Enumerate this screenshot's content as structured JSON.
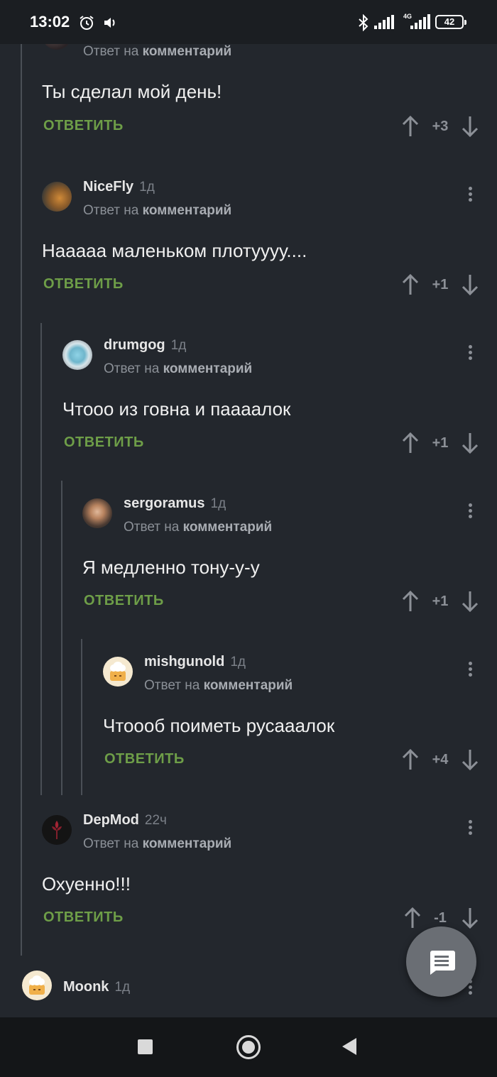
{
  "status_bar": {
    "time": "13:02",
    "network": "4G",
    "battery": "42"
  },
  "labels": {
    "reply_to_prefix": "Ответ на",
    "reply_to_target": "комментарий",
    "reply_button": "ОТВЕТИТЬ"
  },
  "comments": [
    {
      "author": "",
      "time": "",
      "text": "Ты сделал мой день!",
      "score": "+3"
    },
    {
      "author": "NiceFly",
      "time": "1д",
      "text": "Нааааа маленьком плотуууу....",
      "score": "+1"
    },
    {
      "author": "drumgog",
      "time": "1д",
      "text": "Чтооо из говна и паааалок",
      "score": "+1"
    },
    {
      "author": "sergoramus",
      "time": "1д",
      "text": "Я медленно тону-у-у",
      "score": "+1"
    },
    {
      "author": "mishgunold",
      "time": "1д",
      "text": "Чтоооб поиметь русааалок",
      "score": "+4"
    },
    {
      "author": "DepMod",
      "time": "22ч",
      "text": "Охуенно!!!",
      "score": "-1"
    },
    {
      "author": "Moonk",
      "time": "1д",
      "text": "",
      "score": ""
    }
  ],
  "colors": {
    "background": "#23272d",
    "accent_reply": "#6e9e48",
    "fab": "#6a6e74"
  },
  "icons": {
    "fab": "comment-icon",
    "vote_up": "arrow-up-icon",
    "vote_down": "arrow-down-icon"
  }
}
